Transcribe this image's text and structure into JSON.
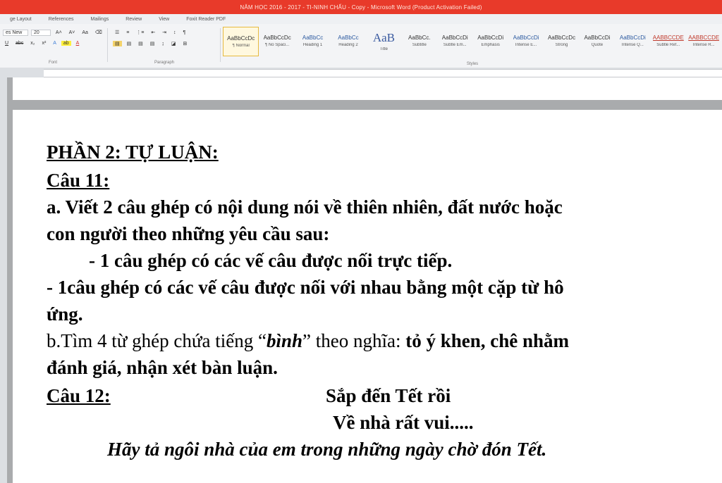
{
  "window": {
    "title": "NĂM HỌC 2016 - 2017 - TI-NINH CHẤU - Copy - Microsoft Word (Product Activation Failed)"
  },
  "ribbon": {
    "tabs": [
      "ge Layout",
      "References",
      "Mailings",
      "Review",
      "View",
      "Foxit Reader PDF"
    ],
    "font_name": "es New",
    "font_size": "20",
    "group_font": "Font",
    "group_paragraph": "Paragraph",
    "group_styles": "Styles",
    "styles": [
      {
        "sample": "AaBbCcDc",
        "name": "¶ Normal",
        "kind": "normal"
      },
      {
        "sample": "AaBbCcDc",
        "name": "¶ No Spaci...",
        "kind": "normal"
      },
      {
        "sample": "AaBbCc",
        "name": "Heading 1",
        "kind": "blue"
      },
      {
        "sample": "AaBbCc",
        "name": "Heading 2",
        "kind": "blue"
      },
      {
        "sample": "AaB",
        "name": "Title",
        "kind": "big"
      },
      {
        "sample": "AaBbCc.",
        "name": "Subtitle",
        "kind": "normal"
      },
      {
        "sample": "AaBbCcDi",
        "name": "Subtle Em...",
        "kind": "normal"
      },
      {
        "sample": "AaBbCcDi",
        "name": "Emphasis",
        "kind": "normal"
      },
      {
        "sample": "AaBbCcDi",
        "name": "Intense E...",
        "kind": "blue"
      },
      {
        "sample": "AaBbCcDc",
        "name": "Strong",
        "kind": "normal"
      },
      {
        "sample": "AaBbCcDi",
        "name": "Quote",
        "kind": "normal"
      },
      {
        "sample": "AaBbCcDi",
        "name": "Intense Q...",
        "kind": "blue"
      },
      {
        "sample": "AABBCCDE",
        "name": "Subtle Ref...",
        "kind": "red"
      },
      {
        "sample": "AABBCCDE",
        "name": "Intense R...",
        "kind": "red"
      }
    ]
  },
  "doc": {
    "heading": "PHẦN 2: TỰ LUẬN:",
    "q11_title": "Câu 11:",
    "q11a_line1": "a. Viết 2 câu ghép có nội dung nói về thiên nhiên, đất nước hoặc",
    "q11a_line2": "con người theo những yêu cầu sau:",
    "q11a_item1": "- 1 câu ghép có các vế câu được nối trực tiếp.",
    "q11a_item2_line1": "- 1câu ghép có các vế câu được nối với nhau bằng một cặp từ hô",
    "q11a_item2_line2": "ứng.",
    "q11b_prefix": "b.Tìm 4 từ ghép chứa tiếng “",
    "q11b_word": "bình",
    "q11b_mid": "” theo nghĩa: ",
    "q11b_bold": "tỏ ý khen, chê nhằm",
    "q11b_line2": "đánh giá, nhận xét bàn luận.",
    "q12_title": "Câu 12:",
    "q12_poem1": "Sắp đến Tết rồi",
    "q12_poem2": "Về nhà rất vui.....",
    "q12_task": "Hãy tả ngôi nhà của em trong những ngày chờ đón Tết."
  }
}
